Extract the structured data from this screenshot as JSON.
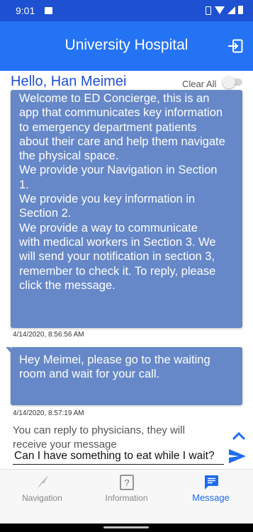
{
  "status_bar": {
    "time": "9:01",
    "icons": [
      "photo-icon",
      "vibrate-icon",
      "wifi-icon",
      "signal-icon",
      "battery-icon"
    ]
  },
  "header": {
    "title": "University Hospital",
    "logout_icon": "logout-icon",
    "color": "#2573f5"
  },
  "greeting": "Hello, Han Meimei",
  "clear_all": {
    "label": "Clear All",
    "on": false
  },
  "messages": [
    {
      "lines": [
        "Welcome to ED Concierge, this is an",
        "app that communicates key information",
        "to emergency department patients",
        "about their care and help them navigate",
        "the physical space.",
        "We provide your Navigation in Section",
        "1.",
        "We provide you key information in",
        "Section 2.",
        "We provide a way to communicate",
        "with medical workers in Section 3. We",
        "will send your notification in section 3,",
        "remember to check it. To reply, please",
        "click the message."
      ],
      "timestamp": "4/14/2020, 8:56:56 AM"
    },
    {
      "lines": [
        "Hey Meimei, please go to the waiting",
        "room and wait for your call."
      ],
      "timestamp": "4/14/2020, 8:57:19 AM"
    }
  ],
  "bubble_color": "#6688c8",
  "reply": {
    "hint": "You can reply to physicians, they will receive your message",
    "value": "Can I have something to eat while I wait?",
    "placeholder": ""
  },
  "bottom_nav": [
    {
      "label": "Navigation",
      "icon": "navigation-icon",
      "active": false
    },
    {
      "label": "Information",
      "icon": "information-icon",
      "active": false
    },
    {
      "label": "Message",
      "icon": "message-icon",
      "active": true
    }
  ],
  "accent_color": "#1e6cf0"
}
